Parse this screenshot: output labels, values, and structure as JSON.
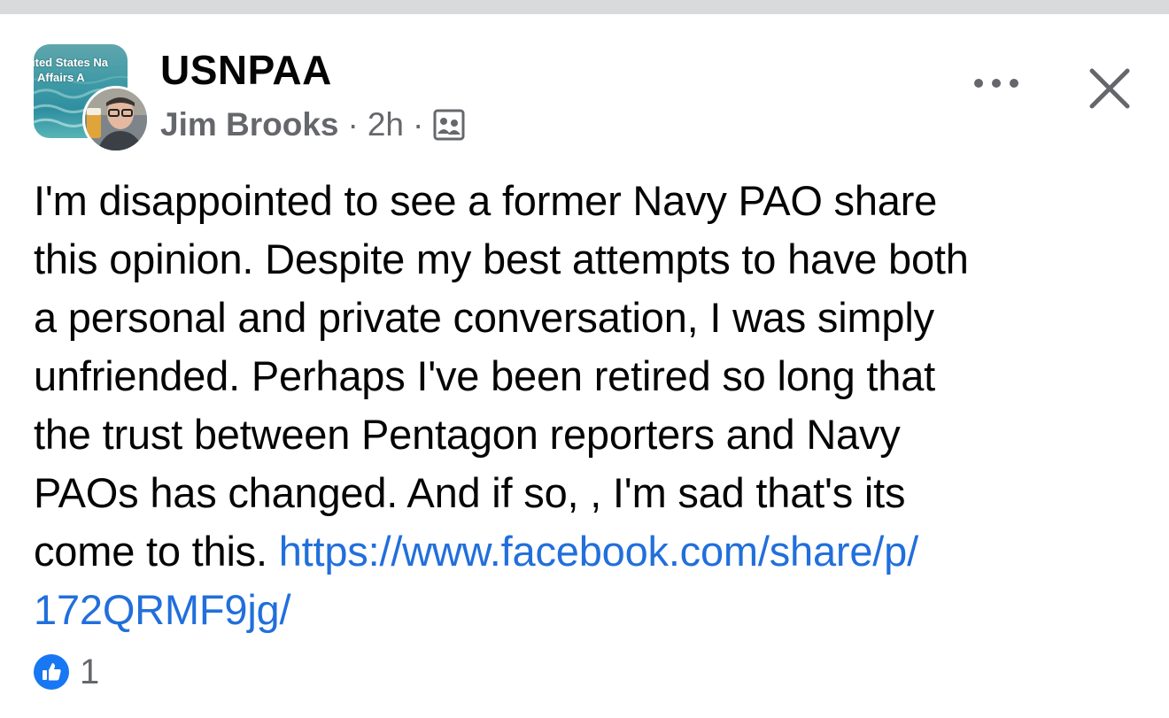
{
  "post": {
    "group_name": "USNPAA",
    "group_avatar_text_line1": "ited States Na",
    "group_avatar_text_line2": "Affairs A",
    "author": "Jim Brooks",
    "separator": "·",
    "time": "2h",
    "audience_icon": "group-audience-icon",
    "more_icon": "ellipsis-icon",
    "close_icon": "close-icon",
    "body_lines": [
      "I'm disappointed to see a former Navy PAO share",
      "this opinion. Despite my best attempts to have both",
      "a personal and private conversation, I was simply",
      "unfriended. Perhaps I've been retired so long that",
      "the trust between Pentagon reporters and Navy",
      "PAOs has changed. And if so, , I'm sad that's its"
    ],
    "body_last_line_text": "come to this. ",
    "link_part1": "https://www.facebook.com/share/p/",
    "link_part2": "172QRMF9jg/",
    "reaction_icon": "like-icon",
    "reaction_count": "1"
  },
  "colors": {
    "link": "#216fdb",
    "like_badge": "#1877f2",
    "meta_text": "#65676b",
    "top_strip": "#d9dadc"
  }
}
